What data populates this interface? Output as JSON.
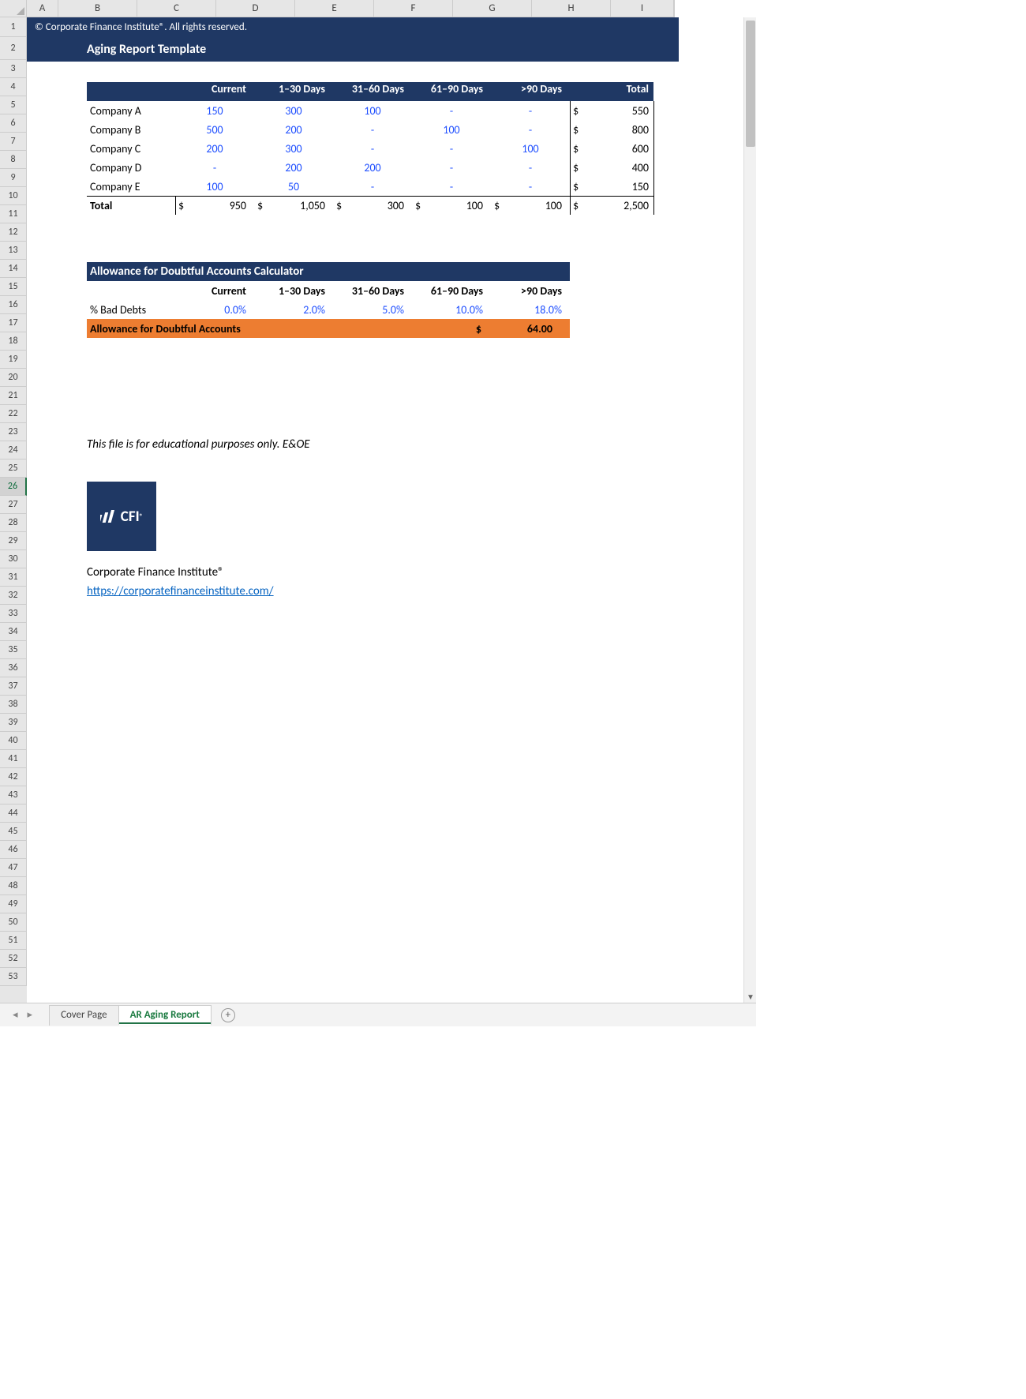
{
  "columns": [
    "A",
    "B",
    "C",
    "D",
    "E",
    "F",
    "G",
    "H",
    "I"
  ],
  "rowCount": 53,
  "selectedRow": 26,
  "banner": {
    "copyright": "© Corporate Finance Institute®. All rights reserved.",
    "title": "Aging Report Template"
  },
  "aging": {
    "headers": [
      "Current",
      "1–30 Days",
      "31–60 Days",
      "61–90 Days",
      ">90 Days",
      "Total"
    ],
    "rows": [
      {
        "name": "Company A",
        "vals": [
          "150",
          "300",
          "100",
          "-",
          "-"
        ],
        "total": "550"
      },
      {
        "name": "Company B",
        "vals": [
          "500",
          "200",
          "-",
          "100",
          "-"
        ],
        "total": "800"
      },
      {
        "name": "Company C",
        "vals": [
          "200",
          "300",
          "-",
          "-",
          "100"
        ],
        "total": "600"
      },
      {
        "name": "Company D",
        "vals": [
          "-",
          "200",
          "200",
          "-",
          "-"
        ],
        "total": "400"
      },
      {
        "name": "Company E",
        "vals": [
          "100",
          "50",
          "-",
          "-",
          "-"
        ],
        "total": "150"
      }
    ],
    "totalLabel": "Total",
    "totals": [
      "950",
      "1,050",
      "300",
      "100",
      "100"
    ],
    "grandTotal": "2,500",
    "dollar": "$"
  },
  "allowance": {
    "heading": "Allowance for Doubtful Accounts Calculator",
    "cols": [
      "Current",
      "1–30 Days",
      "31–60 Days",
      "61–90 Days",
      ">90 Days"
    ],
    "badDebtsLabel": "% Bad Debts",
    "badDebts": [
      "0.0%",
      "2.0%",
      "5.0%",
      "10.0%",
      "18.0%"
    ],
    "outLabel": "Allowance for Doubtful Accounts",
    "outDollar": "$",
    "outValue": "64.00"
  },
  "note": "This file is for educational purposes only. E&OE",
  "logoText": "CFI",
  "orgName": "Corporate Finance Institute®",
  "url": "https://corporatefinanceinstitute.com/",
  "tabs": {
    "items": [
      {
        "label": "Cover Page",
        "active": false
      },
      {
        "label": "AR Aging Report",
        "active": true
      }
    ]
  },
  "chart_data": {
    "type": "table",
    "title": "Aging Report",
    "columns": [
      "Company",
      "Current",
      "1–30 Days",
      "31–60 Days",
      "61–90 Days",
      ">90 Days",
      "Total"
    ],
    "rows": [
      [
        "Company A",
        150,
        300,
        100,
        0,
        0,
        550
      ],
      [
        "Company B",
        500,
        200,
        0,
        100,
        0,
        800
      ],
      [
        "Company C",
        200,
        300,
        0,
        0,
        100,
        600
      ],
      [
        "Company D",
        0,
        200,
        200,
        0,
        0,
        400
      ],
      [
        "Company E",
        100,
        50,
        0,
        0,
        0,
        150
      ],
      [
        "Total",
        950,
        1050,
        300,
        100,
        100,
        2500
      ]
    ],
    "bad_debt_pct": {
      "Current": 0.0,
      "1–30 Days": 0.02,
      "31–60 Days": 0.05,
      "61–90 Days": 0.1,
      ">90 Days": 0.18
    },
    "allowance_for_doubtful_accounts": 64.0
  }
}
